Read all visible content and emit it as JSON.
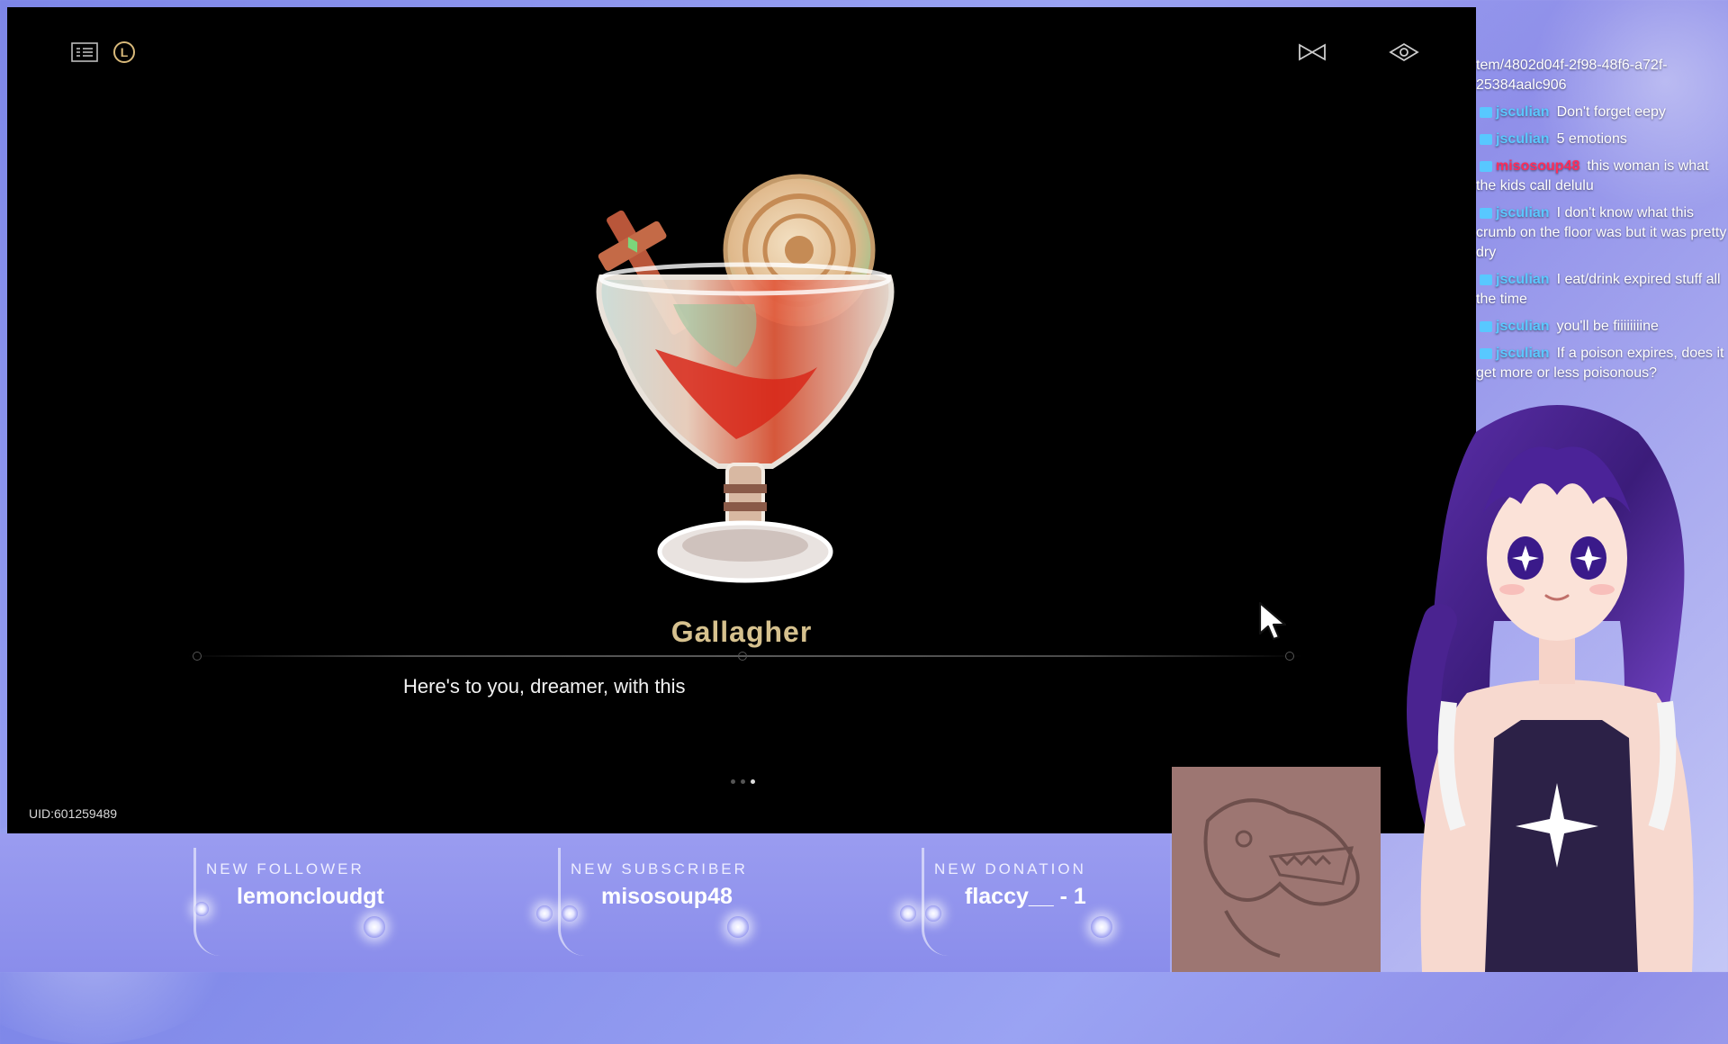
{
  "game": {
    "dish_name": "Gallagher",
    "dialogue": "Here's to you, dreamer, with this",
    "uid": "UID:601259489",
    "pager": {
      "total": 3,
      "active": 3
    },
    "icons": [
      "list-icon",
      "l-button-icon",
      "skip-icon",
      "hide-ui-icon"
    ]
  },
  "chat": {
    "lines": [
      {
        "user": "",
        "text": "tem/4802d04f-2f98-48f6-a72f-25384aalc906",
        "color": "#ffffff"
      },
      {
        "user": "jsculian",
        "text": "Don't forget eepy",
        "color": "#5bc8ff"
      },
      {
        "user": "jsculian",
        "text": "5 emotions",
        "color": "#5bc8ff"
      },
      {
        "user": "misosoup48",
        "text": "this woman is what the kids call delulu",
        "color": "#ff2c5a"
      },
      {
        "user": "jsculian",
        "text": "I don't know what this crumb on the floor was but it was pretty dry",
        "color": "#5bc8ff"
      },
      {
        "user": "jsculian",
        "text": "I eat/drink expired stuff all the time",
        "color": "#5bc8ff"
      },
      {
        "user": "jsculian",
        "text": "you'll be fiiiiiiiine",
        "color": "#5bc8ff"
      },
      {
        "user": "jsculian",
        "text": "If a poison expires, does it get more or less poisonous?",
        "color": "#5bc8ff"
      }
    ]
  },
  "alerts": [
    {
      "label": "NEW FOLLOWER",
      "value": "lemoncloudgt"
    },
    {
      "label": "NEW SUBSCRIBER",
      "value": "misosoup48"
    },
    {
      "label": "NEW DONATION",
      "value": "flaccy__ - 1"
    }
  ]
}
